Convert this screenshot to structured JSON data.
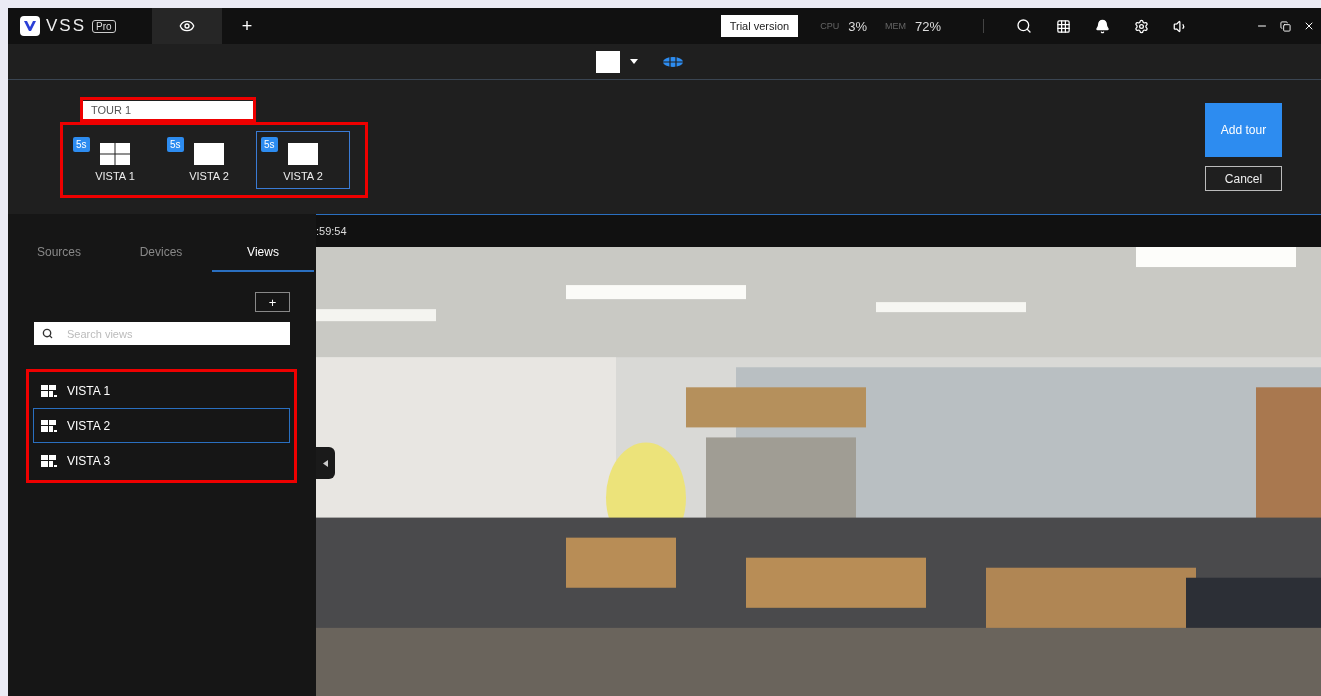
{
  "app": {
    "logo": "VSS",
    "edition": "Pro"
  },
  "tabs": [
    {
      "kind": "eye",
      "selected": true
    },
    {
      "kind": "add",
      "label": "+",
      "selected": false
    }
  ],
  "status": {
    "trial": "Trial version",
    "cpu_label": "CPU",
    "cpu": "3%",
    "mem_label": "MEM",
    "mem": "72%"
  },
  "tour": {
    "name": "TOUR 1",
    "items": [
      {
        "label": "VISTA 1",
        "duration": "5s",
        "kind": "quad",
        "selected": false
      },
      {
        "label": "VISTA 2",
        "duration": "5s",
        "kind": "single",
        "selected": false
      },
      {
        "label": "VISTA 2",
        "duration": "5s",
        "kind": "single",
        "selected": true
      }
    ],
    "add": "Add tour",
    "cancel": "Cancel"
  },
  "video": {
    "time": ":59:54"
  },
  "sidebar": {
    "tabs": [
      {
        "label": "Sources",
        "selected": false
      },
      {
        "label": "Devices",
        "selected": false
      },
      {
        "label": "Views",
        "selected": true
      }
    ],
    "add": "+",
    "search_placeholder": "Search views",
    "views": [
      {
        "label": "VISTA 1",
        "selected": false
      },
      {
        "label": "VISTA 2",
        "selected": true
      },
      {
        "label": "VISTA 3",
        "selected": false
      }
    ]
  }
}
